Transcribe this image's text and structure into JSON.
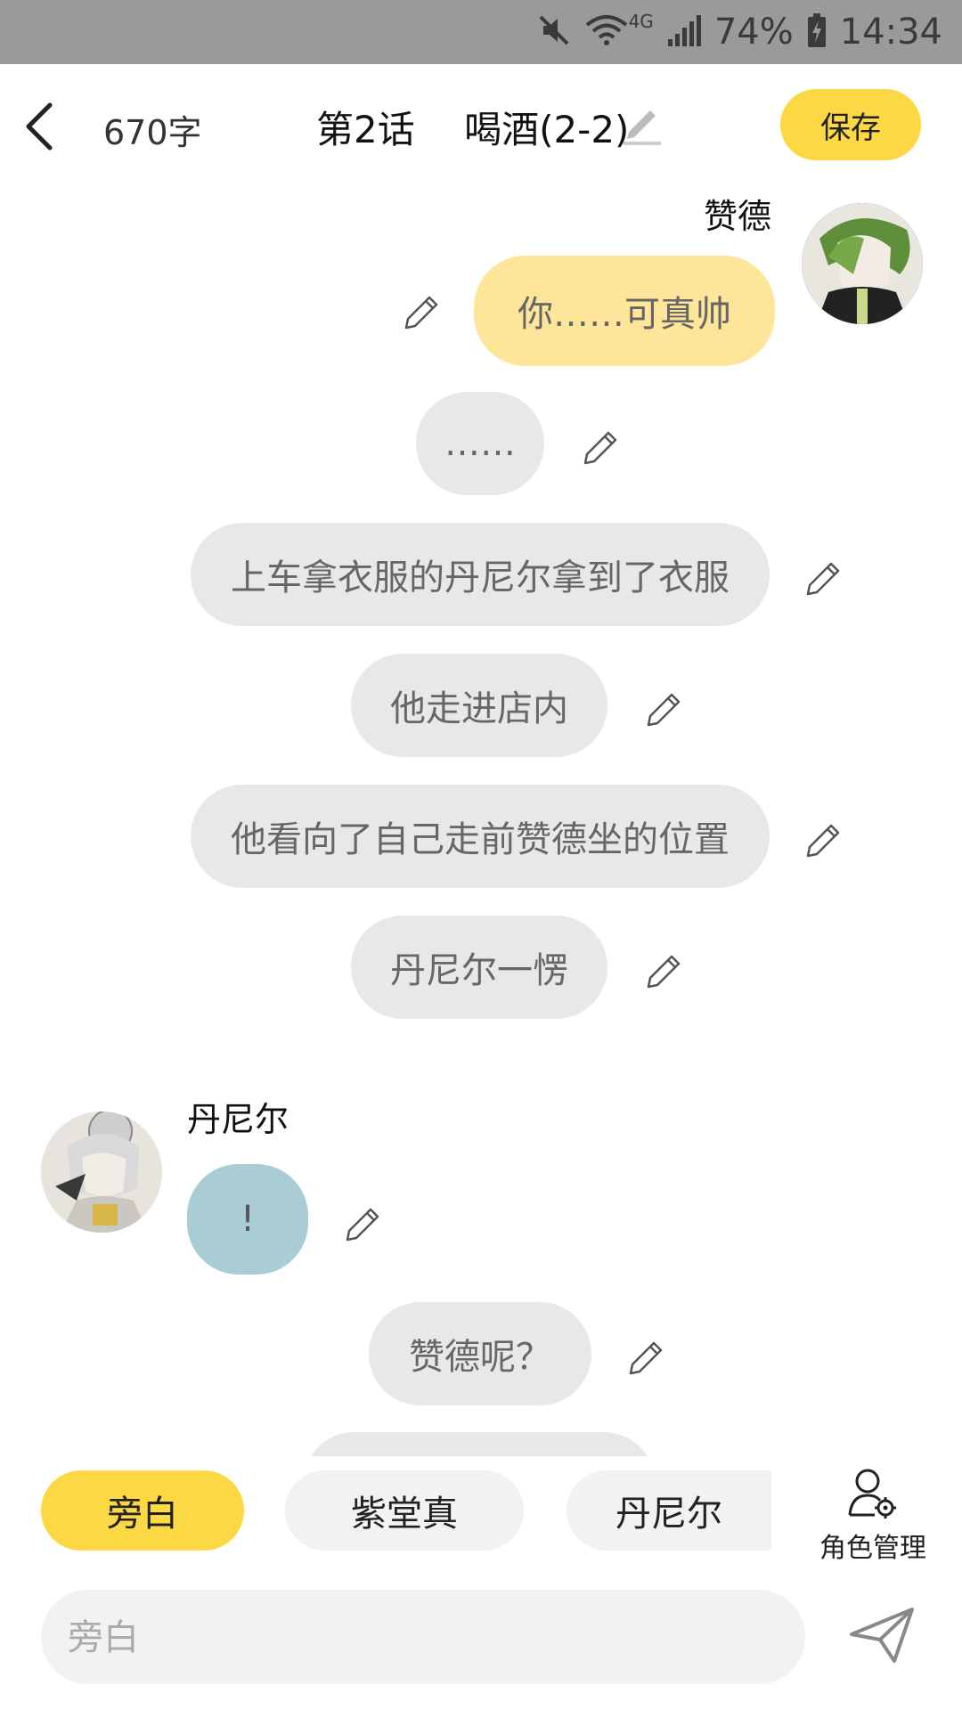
{
  "status_bar": {
    "battery": "74%",
    "time": "14:34",
    "network": "4G",
    "icons": [
      "mute-icon",
      "wifi-icon",
      "signal-icon",
      "battery-charging-icon"
    ]
  },
  "header": {
    "word_count": "670字",
    "title": "第2话　 喝酒(2-2)",
    "save_label": "保存"
  },
  "messages": [
    {
      "type": "right",
      "speaker": "赞德",
      "text": "你……可真帅"
    },
    {
      "type": "narration",
      "text": "……"
    },
    {
      "type": "narration",
      "text": "上车拿衣服的丹尼尔拿到了衣服"
    },
    {
      "type": "narration",
      "text": "他走进店内"
    },
    {
      "type": "narration",
      "text": "他看向了自己走前赞德坐的位置"
    },
    {
      "type": "narration",
      "text": "丹尼尔一愣"
    },
    {
      "type": "left",
      "speaker": "丹尼尔",
      "text": "!"
    },
    {
      "type": "narration",
      "text": "赞德呢？"
    }
  ],
  "roles": [
    "旁白",
    "紫堂真",
    "丹尼尔"
  ],
  "role_manage_label": "角色管理",
  "input": {
    "placeholder": "旁白"
  },
  "colors": {
    "accent": "#fbd844",
    "right_bubble": "#fde699",
    "left_bubble": "#a9ccd5",
    "narration_bubble": "#e8e8e8",
    "status_bar": "#9a9a9a"
  }
}
